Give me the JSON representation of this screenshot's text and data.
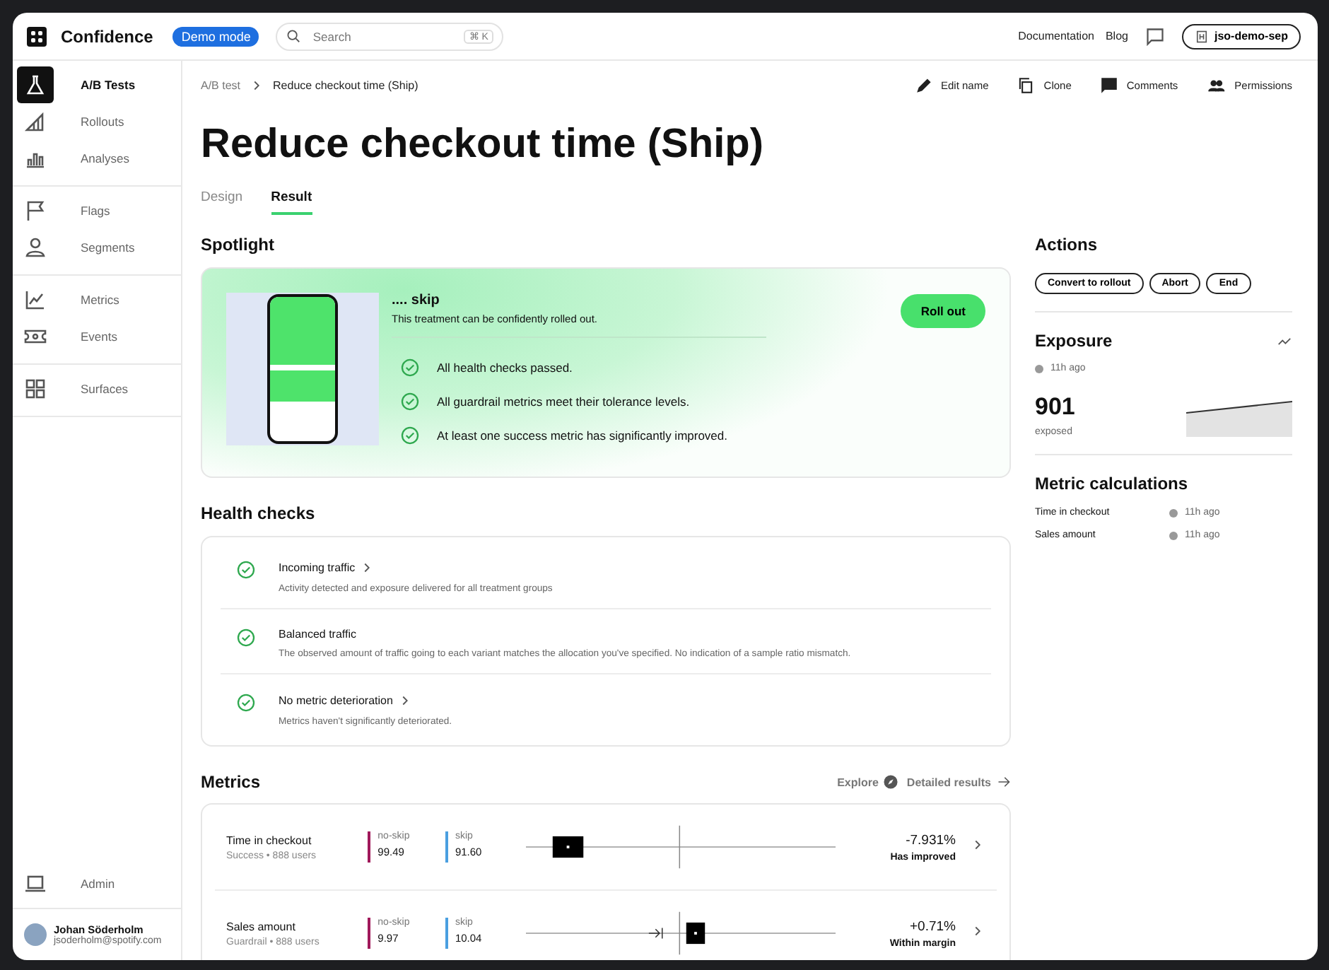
{
  "topbar": {
    "brand": "Confidence",
    "badge": "Demo mode",
    "search": {
      "placeholder": "Search",
      "shortcut": "⌘ K"
    },
    "links": [
      "Documentation",
      "Blog"
    ],
    "workspace": "jso-demo-sep"
  },
  "sidebar": {
    "sections": [
      {
        "items": [
          {
            "label": "A/B Tests",
            "selected": true
          },
          {
            "label": "Rollouts",
            "selected": false
          },
          {
            "label": "Analyses",
            "selected": false
          }
        ]
      },
      {
        "items": [
          {
            "label": "Flags",
            "selected": false
          },
          {
            "label": "Segments",
            "selected": false
          }
        ]
      },
      {
        "items": [
          {
            "label": "Metrics",
            "selected": false
          },
          {
            "label": "Events",
            "selected": false
          }
        ]
      },
      {
        "items": [
          {
            "label": "Surfaces",
            "selected": false
          }
        ]
      }
    ],
    "admin": "Admin",
    "user": {
      "name": "Johan Söderholm",
      "email": "jsoderholm@spotify.com"
    }
  },
  "breadcrumb": [
    "A/B test",
    "Reduce checkout time (Ship)"
  ],
  "page_actions": [
    "Edit name",
    "Clone",
    "Comments",
    "Permissions"
  ],
  "title": "Reduce checkout time (Ship)",
  "tabs": [
    {
      "label": "Design",
      "selected": false
    },
    {
      "label": "Result",
      "selected": true
    }
  ],
  "spotlight": {
    "heading": "Spotlight",
    "variant": ".... skip",
    "summary": "This treatment can be confidently rolled out.",
    "button": "Roll out",
    "checks": [
      "All health checks passed.",
      "All guardrail metrics meet their tolerance levels.",
      "At least one success metric has significantly improved."
    ]
  },
  "health_checks": {
    "heading": "Health checks",
    "items": [
      {
        "title": "Incoming traffic",
        "description": "Activity detected and exposure delivered for all treatment groups",
        "link": true
      },
      {
        "title": "Balanced traffic",
        "description": "The observed amount of traffic going to each variant matches the allocation you've specified. No indication of a sample ratio mismatch.",
        "link": false
      },
      {
        "title": "No metric deterioration",
        "description": "Metrics haven't significantly deteriorated.",
        "link": true
      }
    ]
  },
  "metrics": {
    "heading": "Metrics",
    "explore": "Explore",
    "detailed": "Detailed results",
    "rows": [
      {
        "name": "Time in checkout",
        "subtitle": "Success • 888 users",
        "variants": [
          {
            "label": "no-skip",
            "value": "99.49",
            "color": "#a0195a"
          },
          {
            "label": "skip",
            "value": "91.60",
            "color": "#4a9fe0"
          }
        ],
        "result": "-7.931%",
        "status": "Has improved"
      },
      {
        "name": "Sales amount",
        "subtitle": "Guardrail • 888 users",
        "variants": [
          {
            "label": "no-skip",
            "value": "9.97",
            "color": "#a0195a"
          },
          {
            "label": "skip",
            "value": "10.04",
            "color": "#4a9fe0"
          }
        ],
        "result": "+0.71%",
        "status": "Within margin"
      }
    ]
  },
  "actions": {
    "heading": "Actions",
    "buttons": [
      "Convert to rollout",
      "Abort",
      "End"
    ]
  },
  "exposure": {
    "heading": "Exposure",
    "updated": "11h ago",
    "count": "901",
    "caption": "exposed"
  },
  "metric_calculations": {
    "heading": "Metric calculations",
    "rows": [
      {
        "name": "Time in checkout",
        "updated": "11h ago"
      },
      {
        "name": "Sales amount",
        "updated": "11h ago"
      }
    ]
  }
}
